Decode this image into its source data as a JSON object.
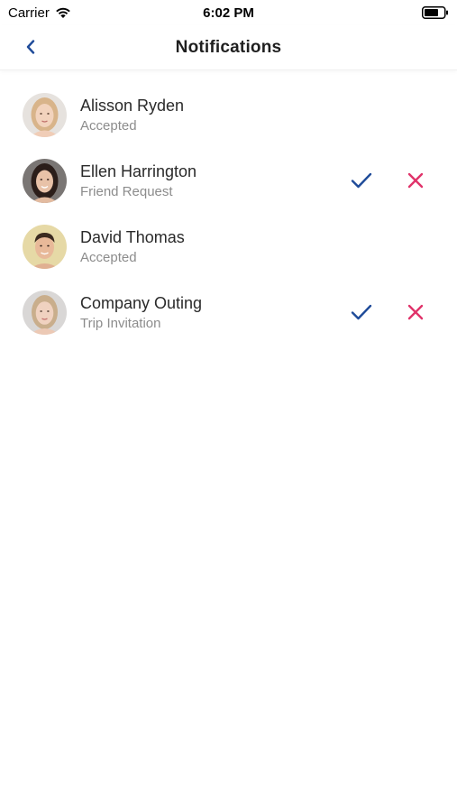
{
  "status_bar": {
    "carrier": "Carrier",
    "time": "6:02 PM"
  },
  "nav": {
    "title": "Notifications"
  },
  "colors": {
    "accent_blue": "#1f4b99",
    "reject_pink": "#e0336a"
  },
  "notifications": [
    {
      "title": "Alisson Ryden",
      "subtitle": "Accepted",
      "actions": false
    },
    {
      "title": "Ellen Harrington",
      "subtitle": "Friend Request",
      "actions": true
    },
    {
      "title": "David Thomas",
      "subtitle": "Accepted",
      "actions": false
    },
    {
      "title": "Company Outing",
      "subtitle": "Trip Invitation",
      "actions": true
    }
  ]
}
